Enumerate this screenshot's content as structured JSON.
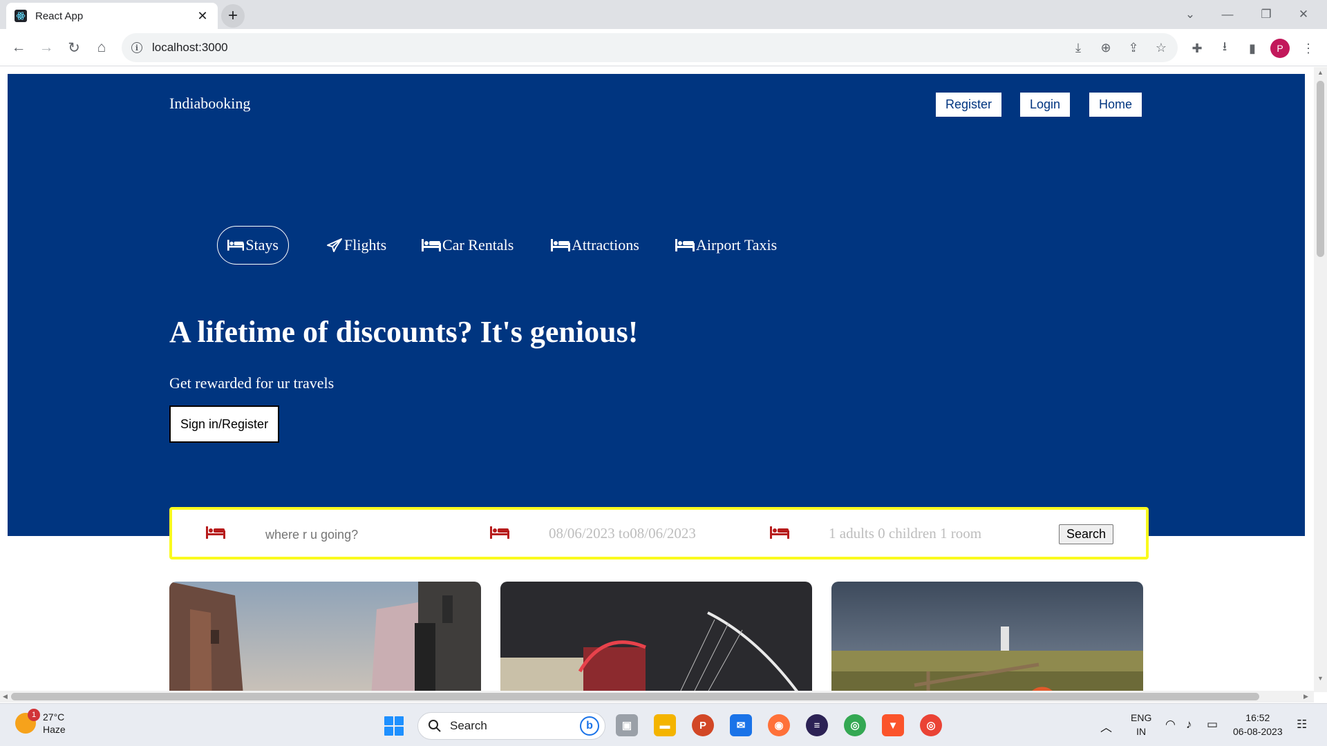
{
  "browser": {
    "tab_title": "React App",
    "tab_close": "✕",
    "new_tab": "+",
    "url": "localhost:3000",
    "window_controls": [
      "⌄",
      "—",
      "❐",
      "✕"
    ]
  },
  "site": {
    "brand": "Indiabooking",
    "header_buttons": [
      "Register",
      "Login",
      "Home"
    ],
    "nav": [
      {
        "label": "Stays",
        "icon": "bed-icon",
        "active": true
      },
      {
        "label": "Flights",
        "icon": "plane-icon",
        "active": false
      },
      {
        "label": "Car Rentals",
        "icon": "bed-icon",
        "active": false
      },
      {
        "label": "Attractions",
        "icon": "bed-icon",
        "active": false
      },
      {
        "label": "Airport Taxis",
        "icon": "bed-icon",
        "active": false
      }
    ],
    "headline": "A lifetime of discounts? It's genious!",
    "subheadline": "Get rewarded for ur travels",
    "signin_button": "Sign in/Register",
    "search": {
      "destination_placeholder": "where r u going?",
      "dates": "08/06/2023 to08/06/2023",
      "guests": "1 adults 0 children 1 room",
      "button": "Search"
    },
    "colors": {
      "hero_bg": "#003580",
      "search_border": "#fafa1e",
      "search_icon": "#b71c1c"
    }
  },
  "taskbar": {
    "weather_temp": "27°C",
    "weather_desc": "Haze",
    "weather_badge": "1",
    "search_label": "Search",
    "lang_1": "ENG",
    "lang_2": "IN",
    "time": "16:52",
    "date": "06-08-2023",
    "profile_initial": "P"
  }
}
